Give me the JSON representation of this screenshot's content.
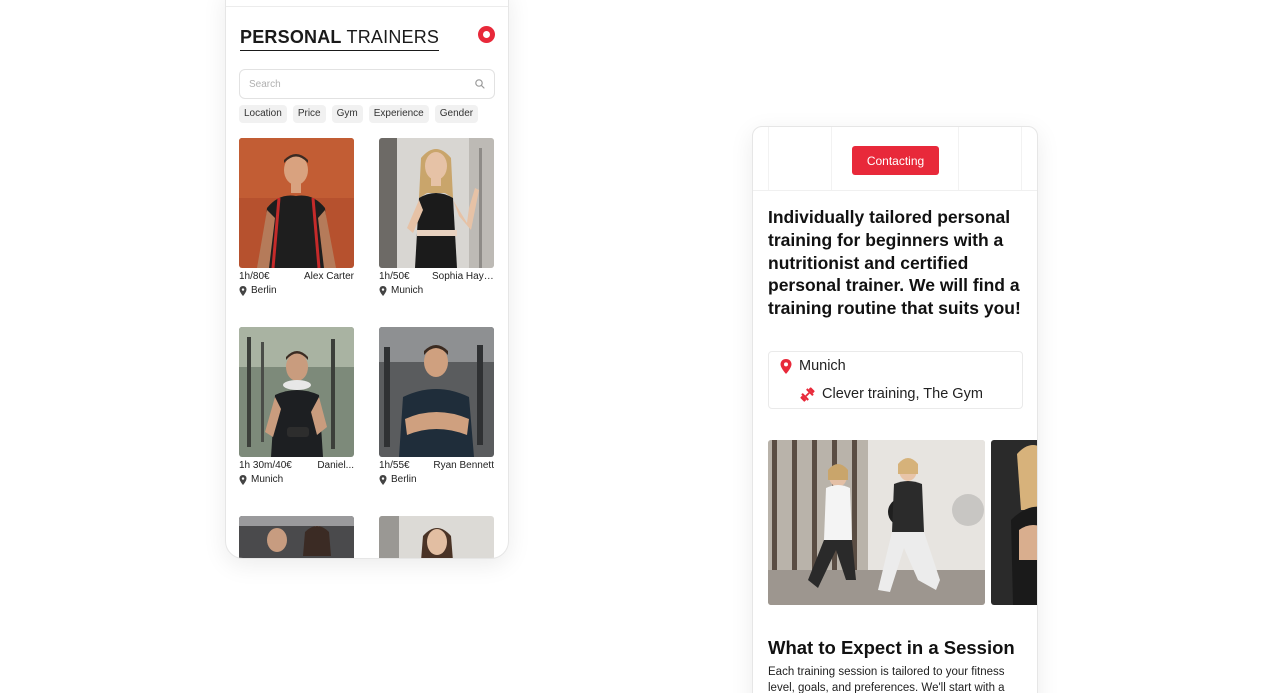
{
  "trainer_list": {
    "title_bold": "PERSONAL",
    "title_rest": "TRAINERS",
    "search": {
      "placeholder": "Search"
    },
    "filters": [
      "Location",
      "Price",
      "Gym",
      "Experience",
      "Gender"
    ],
    "trainers": [
      {
        "price": "1h/80€",
        "name": "Alex Carter",
        "location": "Berlin"
      },
      {
        "price": "1h/50€",
        "name": "Sophia Hayes",
        "location": "Munich"
      },
      {
        "price": "1h 30m/40€",
        "name": "Daniel...",
        "location": "Munich"
      },
      {
        "price": "1h/55€",
        "name": "Ryan Bennett",
        "location": "Berlin"
      }
    ]
  },
  "trainer_detail": {
    "cta_label": "Contacting",
    "headline": "Individually tailored personal training for beginners with a nutritionist and certified personal trainer. We will find a training routine that suits you!",
    "location": "Munich",
    "gyms": "Clever training,  The Gym",
    "section_title": "What to Expect in a Session",
    "section_body": "Each training session is tailored to your fitness level, goals, and preferences. We'll start with a"
  },
  "colors": {
    "accent": "#e8293a",
    "chip_bg": "#f1f1f1"
  },
  "icons": {
    "search": "search-icon",
    "record": "record-dot-icon",
    "pin": "map-pin-icon",
    "dumbbell": "dumbbell-icon"
  }
}
